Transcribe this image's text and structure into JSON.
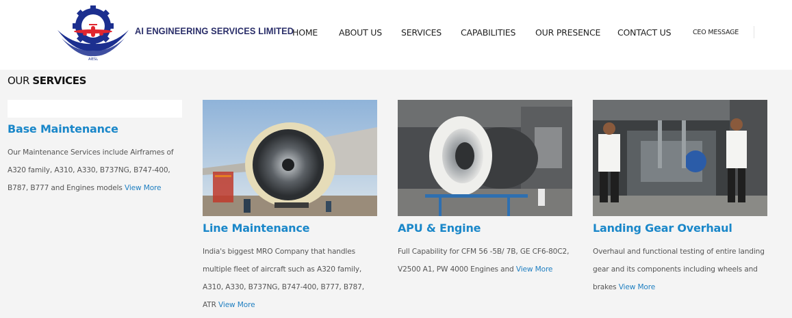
{
  "header": {
    "brand": "AI ENGINEERING SERVICES LIMITED",
    "logo_caption": "AIESL",
    "nav": [
      {
        "label": "HOME"
      },
      {
        "label": "ABOUT US"
      },
      {
        "label": "SERVICES"
      },
      {
        "label": "CAPABILITIES"
      },
      {
        "label": "OUR PRESENCE"
      },
      {
        "label": "CONTACT US"
      },
      {
        "label": "CEO MESSAGE"
      }
    ]
  },
  "section": {
    "title_light": "OUR ",
    "title_bold": "SERVICES"
  },
  "services": [
    {
      "title": "Base Maintenance",
      "text": "Our Maintenance Services include Airframes of A320 family, A310, A330, B737NG, B747-400, B787, B777 and Engines models ",
      "more": "View More"
    },
    {
      "title": "Line Maintenance",
      "text": "India's biggest MRO Company that handles multiple fleet of aircraft such as A320 family, A310, A330, B737NG, B747-400, B777, B787, ATR ",
      "more": "View More"
    },
    {
      "title": "APU & Engine",
      "text": "Full Capability for CFM 56 -5B/ 7B, GE CF6-80C2, V2500 A1, PW 4000 Engines and ",
      "more": "View More"
    },
    {
      "title": "Landing Gear Overhaul",
      "text": "Overhaul and functional testing of entire landing gear and its components including wheels and brakes ",
      "more": "View More"
    }
  ],
  "colors": {
    "accent": "#1a87c9",
    "brand_navy": "#2b2f6a",
    "logo_red": "#e0262f",
    "background": "#f4f4f4"
  }
}
